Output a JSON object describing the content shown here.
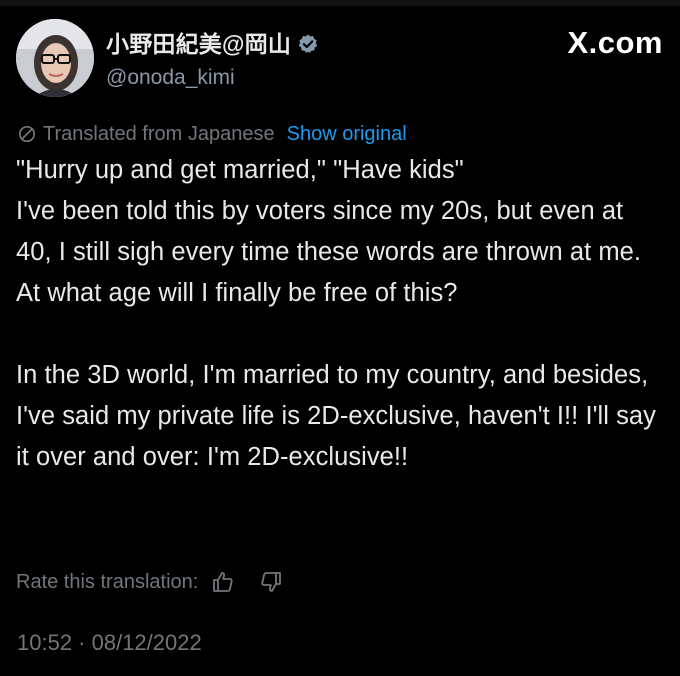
{
  "author": {
    "display_name": "小野田紀美@岡山",
    "handle": "@onoda_kimi",
    "verified_icon": "verified-badge-icon",
    "avatar_icon": "avatar"
  },
  "brand": {
    "logo_text": "X.com"
  },
  "translation": {
    "label": "Translated from Japanese",
    "show_original": "Show original",
    "icon": "translate-icon"
  },
  "tweet": {
    "text": "\"Hurry up and get married,\" \"Have kids\"\nI've been told this by voters since my 20s, but even at 40, I still sigh every time these words are thrown at me. At what age will I finally be free of this?\n\nIn the 3D world, I'm married to my country, and besides, I've said my private life is 2D-exclusive, haven't I!! I'll say it over and over: I'm 2D-exclusive!!"
  },
  "rating": {
    "label": "Rate this translation:",
    "up_icon": "thumbs-up-icon",
    "down_icon": "thumbs-down-icon"
  },
  "meta": {
    "timestamp": "10:52 · 08/12/2022"
  },
  "colors": {
    "background": "#000000",
    "text_primary": "#e7e9ea",
    "text_secondary": "#71767b",
    "link": "#1d9bf0",
    "verified": "#829aab"
  }
}
